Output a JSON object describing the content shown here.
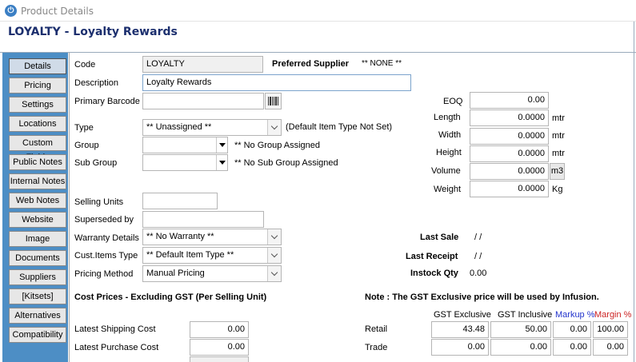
{
  "window": {
    "title": "Product Details"
  },
  "header": {
    "title": "LOYALTY - Loyalty Rewards"
  },
  "sidebar": {
    "items": [
      {
        "label": "Details",
        "active": true
      },
      {
        "label": "Pricing"
      },
      {
        "label": "Settings"
      },
      {
        "label": "Locations"
      },
      {
        "label": "Custom Fields"
      },
      {
        "label": "Public Notes"
      },
      {
        "label": "Internal Notes"
      },
      {
        "label": "Web Notes"
      },
      {
        "label": "Website"
      },
      {
        "label": "Image"
      },
      {
        "label": "Documents"
      },
      {
        "label": "Suppliers"
      },
      {
        "label": "[Kitsets]"
      },
      {
        "label": "Alternatives"
      },
      {
        "label": "Compatibility"
      }
    ]
  },
  "form": {
    "code_label": "Code",
    "code_value": "LOYALTY",
    "preferred_supplier_label": "Preferred Supplier",
    "preferred_supplier_value": "** NONE **",
    "description_label": "Description",
    "description_value": "Loyalty Rewards",
    "barcode_label": "Primary Barcode",
    "barcode_value": "",
    "type_label": "Type",
    "type_value": "** Unassigned **",
    "type_note": "(Default Item Type Not Set)",
    "group_label": "Group",
    "group_value": "",
    "group_note": "** No Group Assigned",
    "subgroup_label": "Sub Group",
    "subgroup_value": "",
    "subgroup_note": "** No Sub Group Assigned",
    "selling_units_label": "Selling Units",
    "selling_units_value": "",
    "superseded_label": "Superseded by",
    "superseded_value": "",
    "warranty_label": "Warranty Details",
    "warranty_value": "** No Warranty **",
    "cust_type_label": "Cust.Items Type",
    "cust_type_value": "** Default Item Type **",
    "pricing_method_label": "Pricing Method",
    "pricing_method_value": "Manual Pricing"
  },
  "dimensions": {
    "eoq_label": "EOQ",
    "eoq_value": "0.00",
    "length_label": "Length",
    "length_value": "0.0000",
    "length_unit": "mtr",
    "width_label": "Width",
    "width_value": "0.0000",
    "width_unit": "mtr",
    "height_label": "Height",
    "height_value": "0.0000",
    "height_unit": "mtr",
    "volume_label": "Volume",
    "volume_value": "0.0000",
    "volume_unit": "m3",
    "weight_label": "Weight",
    "weight_value": "0.0000",
    "weight_unit": "Kg"
  },
  "sales": {
    "last_sale_label": "Last Sale",
    "last_sale_value": "/ /",
    "last_receipt_label": "Last Receipt",
    "last_receipt_value": "/ /",
    "instock_label": "Instock Qty",
    "instock_value": "0.00"
  },
  "costs": {
    "title": "Cost Prices - Excluding GST (Per Selling Unit)",
    "latest_shipping_label": "Latest Shipping Cost",
    "latest_shipping_value": "0.00",
    "latest_purchase_label": "Latest Purchase Cost",
    "latest_purchase_value": "0.00"
  },
  "prices": {
    "note": "Note : The GST Exclusive price will be used by Infusion.",
    "col_gst_exclusive": "GST Exclusive",
    "col_gst_inclusive": "GST Inclusive",
    "col_markup": "Markup %",
    "col_margin": "Margin %",
    "retail_label": "Retail",
    "retail_gst_exclusive": "43.48",
    "retail_gst_inclusive": "50.00",
    "retail_markup": "0.00",
    "retail_margin": "100.00",
    "trade_label": "Trade",
    "trade_gst_exclusive": "0.00",
    "trade_gst_inclusive": "0.00",
    "trade_markup": "0.00",
    "trade_margin": "0.00"
  },
  "colors": {
    "sidebar": "#4d8ec5",
    "header_title": "#1c2f6e",
    "markup": "#2233cc",
    "margin": "#cc2222"
  }
}
